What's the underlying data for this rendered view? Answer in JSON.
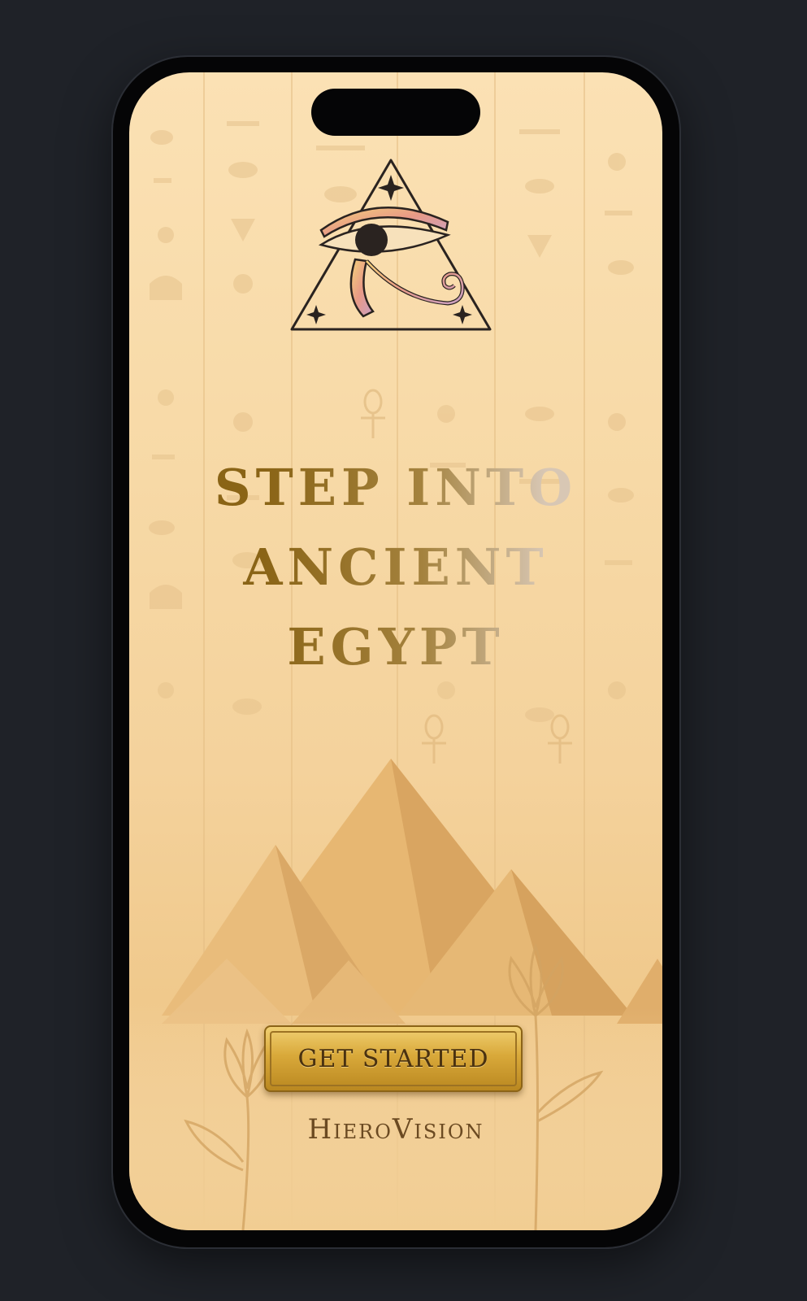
{
  "app": {
    "headline_lines": [
      "STEP INTO",
      "ANCIENT",
      "EGYPT"
    ],
    "cta_label": "GET STARTED",
    "brand_name": "HieroVision"
  },
  "icons": {
    "logo": "eye-of-horus-triangle-icon"
  },
  "colors": {
    "background": "#1f2228",
    "screen_sand": "#f7d9a6",
    "headline_gold": "#8a6416",
    "button_gold": "#d9a93a",
    "brand_text": "#6b4a22"
  }
}
